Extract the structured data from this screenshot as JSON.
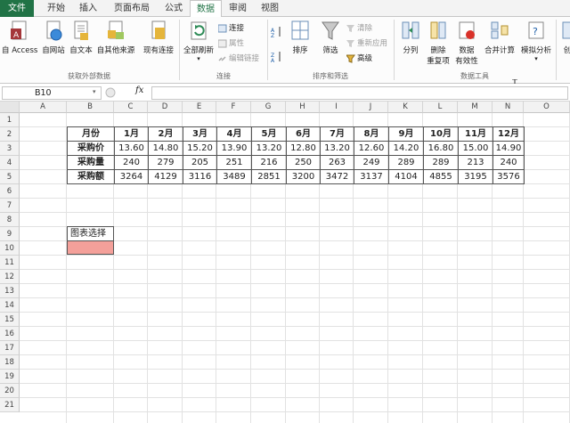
{
  "tabs": [
    "文件",
    "开始",
    "插入",
    "页面布局",
    "公式",
    "数据",
    "审阅",
    "视图"
  ],
  "ribbon": {
    "groups": [
      "获取外部数据",
      "连接",
      "排序和筛选",
      "数据工具"
    ],
    "get_external": [
      "自 Access",
      "自网站",
      "自文本",
      "自其他来源",
      "现有连接"
    ],
    "connections": {
      "refresh": "全部刷新",
      "connections": "连接",
      "properties": "属性",
      "edit_links": "编辑链接"
    },
    "sort_filter": {
      "sort_az": "A↓Z",
      "sort": "排序",
      "filter": "筛选",
      "clear": "清除",
      "reapply": "重新应用",
      "advanced": "高级"
    },
    "data_tools": {
      "split": "分列",
      "remove_dup_1": "删除",
      "remove_dup_2": "重复项",
      "validation_1": "数据",
      "validation_2": "有效性",
      "consolidate": "合并计算",
      "whatif": "模拟分析",
      "more": "创"
    }
  },
  "formula_bar": {
    "name_box": "B10",
    "fx": "fx",
    "formula": ""
  },
  "columns": [
    "A",
    "B",
    "C",
    "D",
    "E",
    "F",
    "G",
    "H",
    "I",
    "J",
    "K",
    "L",
    "M",
    "N",
    "O"
  ],
  "rows": [
    "1",
    "2",
    "3",
    "4",
    "5",
    "6",
    "7",
    "8",
    "9",
    "10",
    "11",
    "12",
    "13",
    "14",
    "15",
    "16",
    "17",
    "18",
    "19",
    "20",
    "21"
  ],
  "table": {
    "header": [
      "月份",
      "1月",
      "2月",
      "3月",
      "4月",
      "5月",
      "6月",
      "7月",
      "8月",
      "9月",
      "10月",
      "11月",
      "12月"
    ],
    "rows": [
      [
        "采购价",
        "13.60",
        "14.80",
        "15.20",
        "13.90",
        "13.20",
        "12.80",
        "13.20",
        "12.60",
        "14.20",
        "16.80",
        "15.00",
        "14.90"
      ],
      [
        "采购量",
        "240",
        "279",
        "205",
        "251",
        "216",
        "250",
        "263",
        "249",
        "289",
        "289",
        "213",
        "240"
      ],
      [
        "采购额",
        "3264",
        "4129",
        "3116",
        "3489",
        "2851",
        "3200",
        "3472",
        "3137",
        "4104",
        "4855",
        "3195",
        "3576"
      ]
    ]
  },
  "chart_select_label": "图表选择",
  "colors": {
    "file_tab": "#217346",
    "selected_cell": "#f4a09a"
  }
}
